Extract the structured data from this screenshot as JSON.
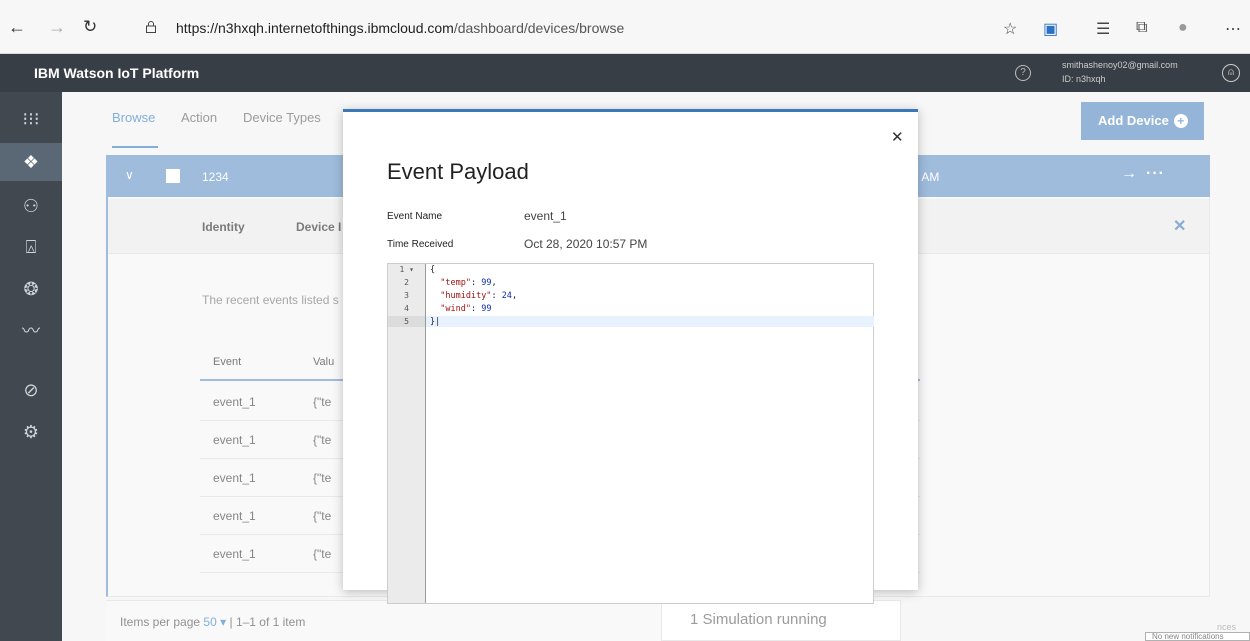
{
  "browser": {
    "url_host": "https://n3hxqh.internetofthings.ibmcloud.com",
    "url_path": "/dashboard/devices/browse"
  },
  "app": {
    "brand": "IBM Watson IoT Platform",
    "help_icon": "?",
    "user_email": "smithashenoy02@gmail.com",
    "user_id": "ID: n3hxqh"
  },
  "tabs": [
    "Browse",
    "Action",
    "Device Types"
  ],
  "add_device_label": "Add Device",
  "device_row": {
    "name": "1234",
    "time_fragment": "2 AM"
  },
  "device_panel": {
    "tab_identity": "Identity",
    "tab_device": "Device I",
    "description": "The recent events listed s",
    "table_headers": [
      "Event",
      "Valu"
    ],
    "rows": [
      {
        "event": "event_1",
        "value": "{\"te"
      },
      {
        "event": "event_1",
        "value": "{\"te"
      },
      {
        "event": "event_1",
        "value": "{\"te"
      },
      {
        "event": "event_1",
        "value": "{\"te"
      },
      {
        "event": "event_1",
        "value": "{\"te"
      }
    ]
  },
  "footer": {
    "items_per_page_label": "Items per page",
    "items_per_page_value": "50",
    "range": "1–1 of 1 item",
    "simulation": "1 Simulation running",
    "notification": "No new notifications",
    "corner_fragment": "nces"
  },
  "modal": {
    "title": "Event Payload",
    "event_name_label": "Event Name",
    "event_name_value": "event_1",
    "time_received_label": "Time Received",
    "time_received_value": "Oct 28, 2020 10:57 PM",
    "line_numbers": [
      "1",
      "2",
      "3",
      "4",
      "5"
    ],
    "code": {
      "line1": "{",
      "line2_key": "\"temp\"",
      "line2_val": "99",
      "line3_key": "\"humidity\"",
      "line3_val": "24",
      "line4_key": "\"wind\"",
      "line4_val": "99",
      "line5": "}"
    }
  },
  "colors": {
    "accent": "#3c78b8",
    "device_row": "#6c99cb",
    "header": "#383e45",
    "sidebar": "#42484f"
  }
}
